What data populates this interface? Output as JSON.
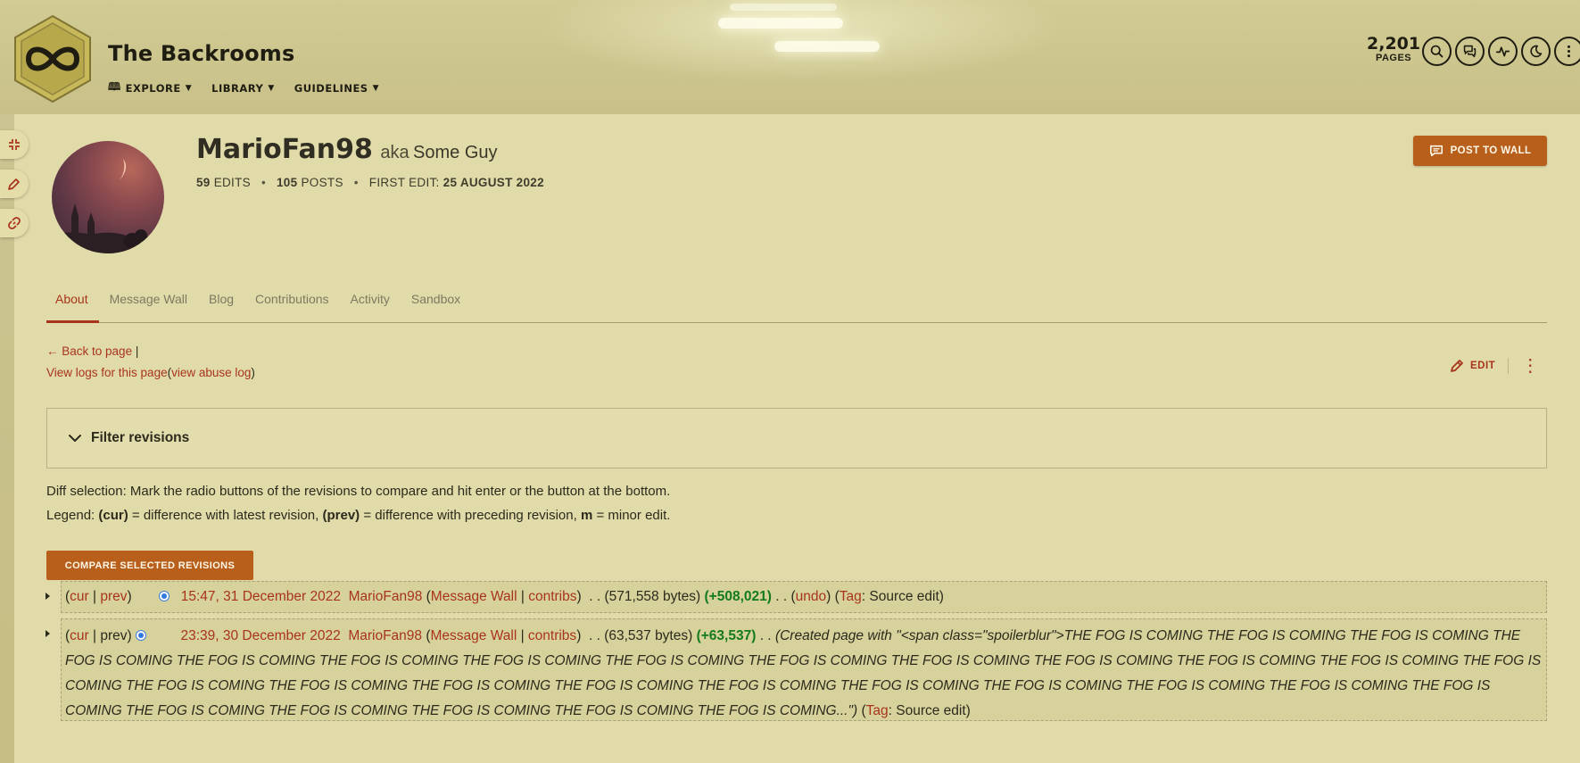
{
  "site": {
    "title": "The Backrooms",
    "nav": [
      {
        "label": "EXPLORE",
        "icon": "book-icon"
      },
      {
        "label": "LIBRARY"
      },
      {
        "label": "GUIDELINES"
      }
    ],
    "page_count": "2,201",
    "page_count_label": "PAGES"
  },
  "header_icons": [
    "search-icon",
    "discussions-icon",
    "activity-icon",
    "theme-toggle-icon",
    "more-icon"
  ],
  "tools": [
    "collapse-icon",
    "edit-pencil-icon",
    "link-icon"
  ],
  "user": {
    "name": "MarioFan98",
    "aka": "aka",
    "aka_name": "Some Guy",
    "edits_count": "59",
    "edits_label": "EDITS",
    "posts_count": "105",
    "posts_label": "POSTS",
    "first_edit_label": "FIRST EDIT:",
    "first_edit_date": "25 AUGUST 2022",
    "post_to_wall": "POST TO WALL"
  },
  "tabs": [
    {
      "label": "About",
      "active": true
    },
    {
      "label": "Message Wall"
    },
    {
      "label": "Blog"
    },
    {
      "label": "Contributions"
    },
    {
      "label": "Activity"
    },
    {
      "label": "Sandbox"
    }
  ],
  "page_links": {
    "back": "Back to page",
    "back_sep": "|",
    "view_logs": "View logs for this page",
    "abuse_open": "(",
    "view_abuse": "view abuse log",
    "abuse_close": ")",
    "edit": "EDIT"
  },
  "filter": {
    "title": "Filter revisions"
  },
  "help": {
    "diff_selection": "Diff selection: Mark the radio buttons of the revisions to compare and hit enter or the button at the bottom.",
    "legend_prefix": "Legend: ",
    "cur": "(cur)",
    "cur_desc": " = difference with latest revision, ",
    "prev": "(prev)",
    "prev_desc": " = difference with preceding revision, ",
    "m": "m",
    "m_desc": " = minor edit."
  },
  "compare_button": "COMPARE SELECTED REVISIONS",
  "revisions": [
    {
      "cur": "cur",
      "prev": "prev",
      "timestamp": "15:47, 31 December 2022",
      "user": "MarioFan98",
      "message_wall": "Message Wall",
      "contribs": "contribs",
      "size": "(571,558 bytes)",
      "diff": "(+508,021)",
      "undo": "undo",
      "tag_label": "Tag",
      "tag": "Source edit"
    },
    {
      "cur": "cur",
      "prev": "prev",
      "timestamp": "23:39, 30 December 2022",
      "user": "MarioFan98",
      "message_wall": "Message Wall",
      "contribs": "contribs",
      "size": "(63,537 bytes)",
      "diff": "(+63,537)",
      "summary": "(Created page with \"<span class=\"spoilerblur\">THE FOG IS COMING THE FOG IS COMING THE FOG IS COMING THE FOG IS COMING THE FOG IS COMING THE FOG IS COMING THE FOG IS COMING THE FOG IS COMING THE FOG IS COMING THE FOG IS COMING THE FOG IS COMING THE FOG IS COMING THE FOG IS COMING THE FOG IS COMING THE FOG IS COMING THE FOG IS COMING THE FOG IS COMING THE FOG IS COMING THE FOG IS COMING THE FOG IS COMING THE FOG IS COMING THE FOG IS COMING THE FOG IS COMING THE FOG IS COMING THE FOG IS COMING THE FOG IS COMING THE FOG IS COMING THE FOG IS COMING THE FOG IS COMING...\")",
      "tag_label": "Tag",
      "tag": "Source edit"
    }
  ],
  "colors": {
    "accent": "#a8341c",
    "button": "#b85f1b",
    "positive": "#137a1d",
    "radio": "#2f79e0"
  }
}
